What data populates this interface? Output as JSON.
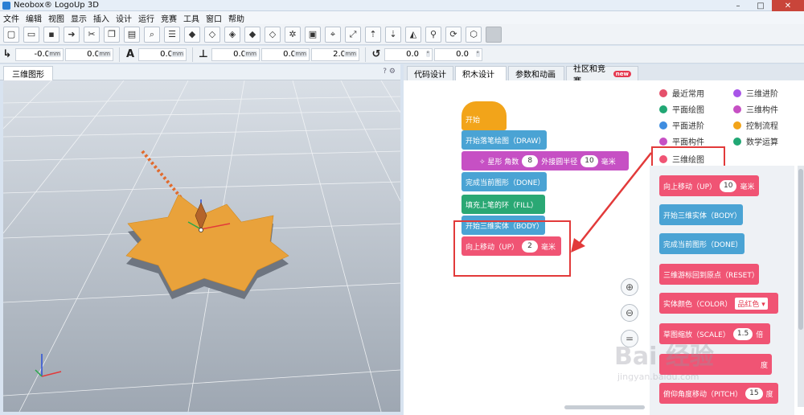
{
  "window": {
    "title": "Neobox® LogoUp 3D",
    "minimize": "–",
    "maximize": "□",
    "close": "✕"
  },
  "menu": [
    "文件",
    "编辑",
    "视图",
    "显示",
    "插入",
    "设计",
    "运行",
    "竞赛",
    "工具",
    "窗口",
    "帮助"
  ],
  "coords": {
    "x": "-0.0",
    "y": "0.0",
    "z": "0.0",
    "ax": "0.0",
    "ay": "0.0",
    "az": "2.0",
    "r1": "0.0",
    "r2": "0.0",
    "unit_mm": "mm",
    "unit_deg": "°"
  },
  "left_panel": {
    "tab": "三维图形",
    "help": "?",
    "settings": "⚙"
  },
  "right_tabs": [
    {
      "label": "代码设计"
    },
    {
      "label": "积木设计"
    },
    {
      "label": "参数和动画"
    },
    {
      "label": "社区和竞赛",
      "badge": "new"
    }
  ],
  "categories": [
    {
      "label": "最近常用",
      "color": "#e5506b"
    },
    {
      "label": "三维进阶",
      "color": "#a855e8"
    },
    {
      "label": "平面绘图",
      "color": "#21a774"
    },
    {
      "label": "三维构件",
      "color": "#c650c4"
    },
    {
      "label": "平面进阶",
      "color": "#3f8de0"
    },
    {
      "label": "控制流程",
      "color": "#f2a41a"
    },
    {
      "label": "平面构件",
      "color": "#c650c4"
    },
    {
      "label": "数学运算",
      "color": "#21a774"
    },
    {
      "label": "三维绘图",
      "color": "#f05474"
    }
  ],
  "script_blocks": {
    "start": "开始",
    "draw": "开始落笔绘图（DRAW）",
    "star_prefix": "✧ 星形 角数",
    "star_points": "8",
    "star_mid": "外接圆半径",
    "star_radius": "10",
    "star_unit": "毫米",
    "done": "完成当前图形（DONE）",
    "fill": "填充上笔的环（FILL）",
    "body": "开始三维实体（BODY）",
    "up_label": "向上移动（UP）",
    "up_value": "2",
    "up_unit": "毫米"
  },
  "flyout_blocks": {
    "up_label": "向上移动（UP）",
    "up_value": "10",
    "up_unit": "毫米",
    "body": "开始三维实体（BODY）",
    "done": "完成当前图形（DONE）",
    "reset": "三维游标回到原点（RESET）",
    "color_label": "实体颜色（COLOR）",
    "color_value": "品红色 ▾",
    "scale_label": "草图缩放（SCALE）",
    "scale_value": "1.5",
    "scale_unit": "倍",
    "yaw_unit": "度",
    "pitch_label": "俯仰角度移动（PITCH）",
    "pitch_value": "15",
    "pitch_unit": "度"
  },
  "zoom": {
    "in": "⊕",
    "out": "⊖",
    "reset": "="
  },
  "watermark": {
    "main": "Bai 经验",
    "sub": "jingyan.baidu.com"
  }
}
